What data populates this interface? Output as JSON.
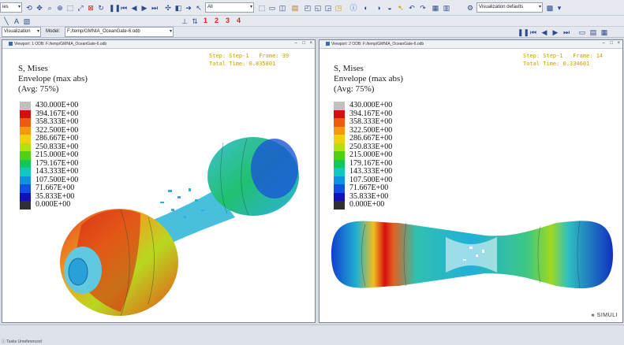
{
  "toolbar": {
    "left_combo": "ies",
    "module_combo": "All",
    "model_label": "Model:",
    "module_label": "Visualization",
    "model_path": "F:/temp/GMNIA_OceanGate-6.odb",
    "viz_defaults": "Visualization defaults",
    "step_numbers": [
      "1",
      "2",
      "3",
      "4"
    ]
  },
  "viewport1": {
    "title": "Viewport: 1    ODB: F:/temp/GMNIA_OceanGate-6.odb",
    "step_line1": "Step: Step-1   Frame: 39",
    "step_line2": "Total Time: 0.835801"
  },
  "viewport2": {
    "title": "Viewport: 2    ODB: F:/temp/GMNIA_OceanGate-6.odb",
    "step_line1": "Step: Step-1   Frame: 14",
    "step_line2": "Total Time: 0.334601"
  },
  "legend": {
    "line1": "S, Mises",
    "line2": "Envelope (max abs)",
    "line3": "(Avg: 75%)",
    "values": [
      "430.000E+00",
      "394.167E+00",
      "358.333E+00",
      "322.500E+00",
      "286.667E+00",
      "250.833E+00",
      "215.000E+00",
      "179.167E+00",
      "143.333E+00",
      "107.500E+00",
      "71.667E+00",
      "35.833E+00",
      "0.000E+00"
    ],
    "colors": [
      "#c0c0c0",
      "#d21010",
      "#ee5a10",
      "#f09a10",
      "#f2d010",
      "#b4e010",
      "#50d010",
      "#10c860",
      "#10c8c0",
      "#1090e0",
      "#1050e0",
      "#1010c0",
      "#303030"
    ]
  },
  "brand": "SIMULI",
  "status": "ⓘ  Tasks   Unreferenced"
}
